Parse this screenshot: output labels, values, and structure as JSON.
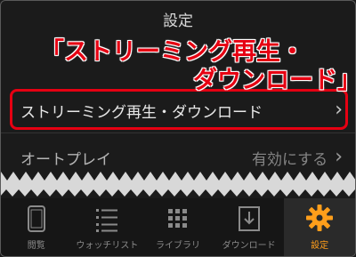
{
  "header": {
    "title": "設定"
  },
  "callout": {
    "line1": "「ストリーミング再生・",
    "line2": "ダウンロード」"
  },
  "rows": {
    "streaming": {
      "label": "ストリーミング再生・ダウンロード"
    },
    "autoplay": {
      "label": "オートプレイ",
      "value": "有効にする"
    }
  },
  "chevron": "›",
  "tabs": [
    {
      "label": "閲覧",
      "icon": "tablet-icon"
    },
    {
      "label": "ウォッチリスト",
      "icon": "list-icon"
    },
    {
      "label": "ライブラリ",
      "icon": "grid-icon"
    },
    {
      "label": "ダウンロード",
      "icon": "download-icon"
    },
    {
      "label": "設定",
      "icon": "gear-icon"
    }
  ],
  "colors": {
    "accent": "#ff9e1b",
    "callout": "#e60012",
    "background": "#1b1b1b"
  }
}
